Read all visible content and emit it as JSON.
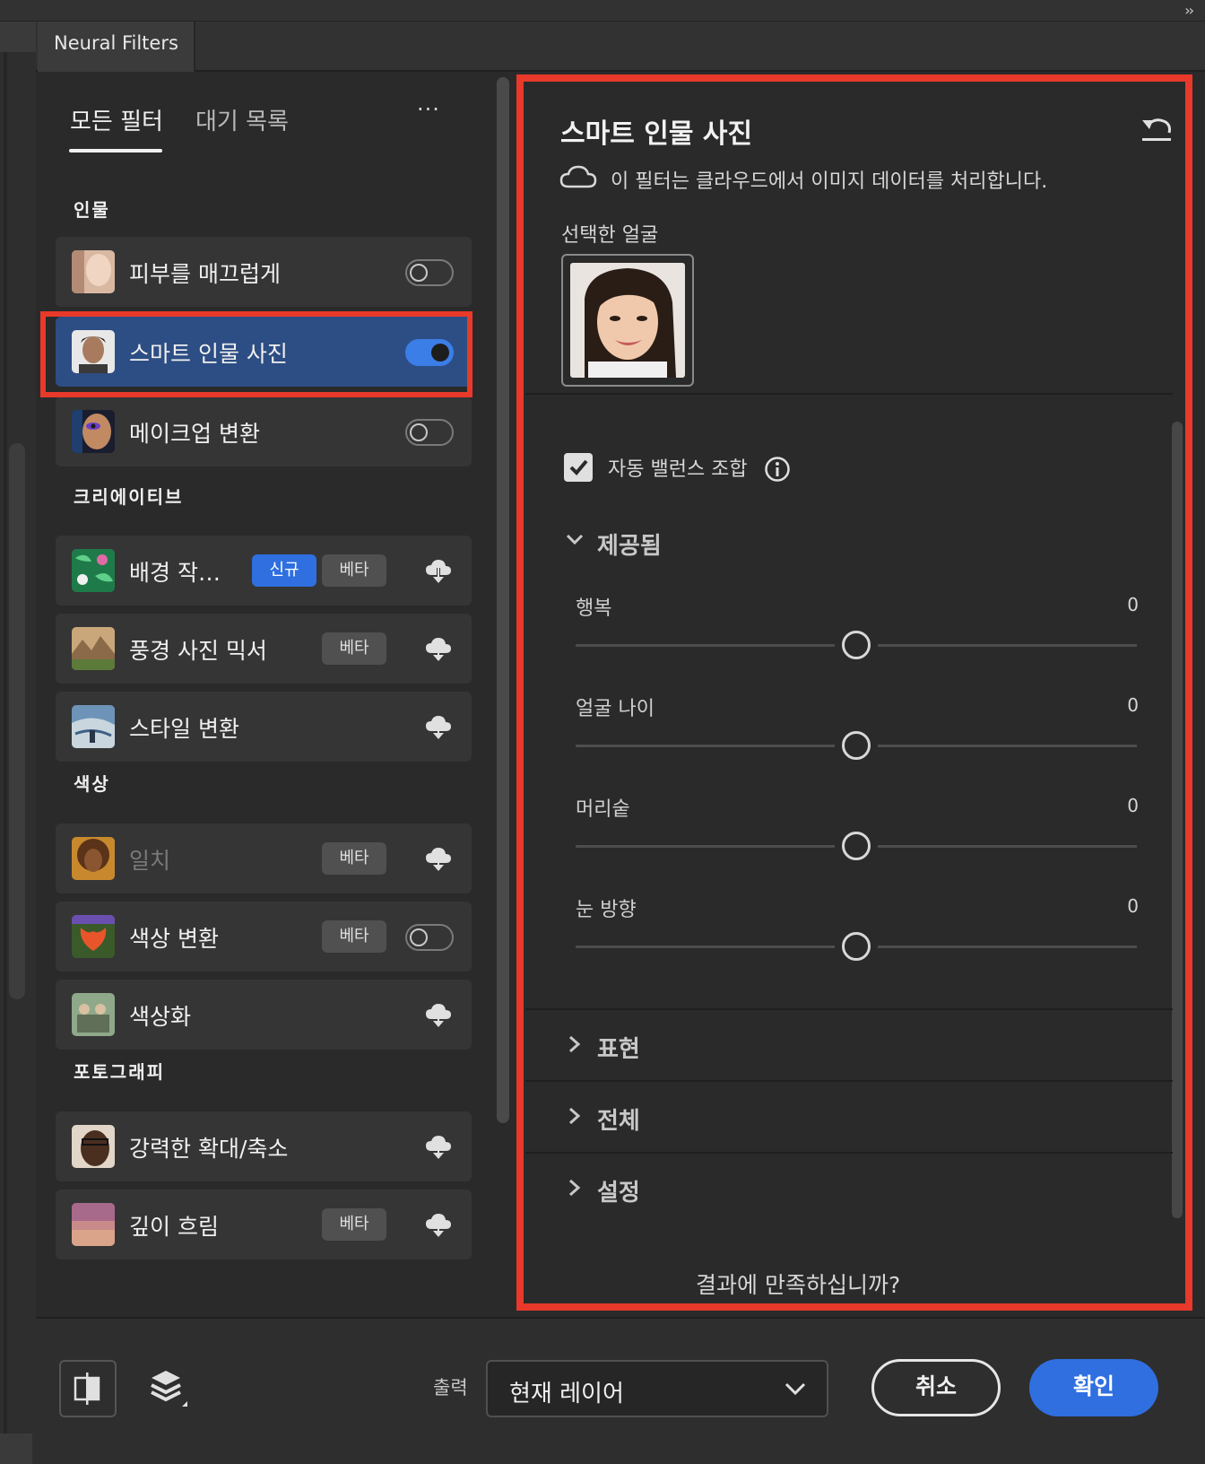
{
  "window": {
    "tab_title": "Neural Filters",
    "collapse_glyph": "››"
  },
  "nav": {
    "all_filters": "모든 필터",
    "wait_list": "대기 목록",
    "more": "···"
  },
  "categories": {
    "portrait": "인물",
    "creative": "크리에이티브",
    "color": "색상",
    "photography": "포토그래피"
  },
  "filters": [
    {
      "name": "피부를 매끄럽게",
      "control": "toggle",
      "enabled": false,
      "thumb": "portrait-thumb"
    },
    {
      "name": "스마트 인물 사진",
      "control": "toggle",
      "enabled": true,
      "active": true,
      "thumb": "portrait-thumb"
    },
    {
      "name": "메이크업 변환",
      "control": "toggle",
      "enabled": false,
      "thumb": "makeup-thumb"
    },
    {
      "name": "배경 작…",
      "badges": [
        "신규",
        "베타"
      ],
      "control": "cloud-download",
      "thumb": "tropical-thumb"
    },
    {
      "name": "풍경 사진 믹서",
      "badges": [
        "베타"
      ],
      "control": "cloud-download",
      "thumb": "landscape-thumb"
    },
    {
      "name": "스타일 변환",
      "control": "cloud-download",
      "thumb": "painting-thumb"
    },
    {
      "name": "일치",
      "badges": [
        "베타"
      ],
      "control": "cloud-download",
      "dimmed": true,
      "thumb": "portrait-thumb"
    },
    {
      "name": "색상 변환",
      "badges": [
        "베타"
      ],
      "control": "toggle",
      "enabled": false,
      "thumb": "flower-thumb"
    },
    {
      "name": "색상화",
      "control": "cloud-download",
      "thumb": "vintage-thumb"
    },
    {
      "name": "강력한 확대/축소",
      "control": "cloud-download",
      "thumb": "portrait-thumb"
    },
    {
      "name": "깊이 흐림",
      "badges": [
        "베타"
      ],
      "control": "cloud-download",
      "thumb": "desert-thumb"
    }
  ],
  "detail": {
    "title": "스마트 인물 사진",
    "cloud_note": "이 필터는 클라우드에서 이미지 데이터를 처리합니다.",
    "selected_face_label": "선택한 얼굴",
    "auto_balance_label": "자동 밸런스 조합",
    "auto_balance_checked": true,
    "provided_section": "제공됨",
    "sliders": [
      {
        "label": "행복",
        "value": "0"
      },
      {
        "label": "얼굴 나이",
        "value": "0"
      },
      {
        "label": "머리숱",
        "value": "0"
      },
      {
        "label": "눈 방향",
        "value": "0"
      }
    ],
    "sections": [
      "표현",
      "전체",
      "설정"
    ],
    "feedback": "결과에 만족하십니까?"
  },
  "footer": {
    "output_label": "출력",
    "output_value": "현재 레이어",
    "cancel": "취소",
    "ok": "확인"
  },
  "colors": {
    "accent": "#2f6fe0",
    "highlight_box": "#e8392a",
    "active_row": "#2d4e84",
    "panel_bg": "#2a2a2a"
  }
}
